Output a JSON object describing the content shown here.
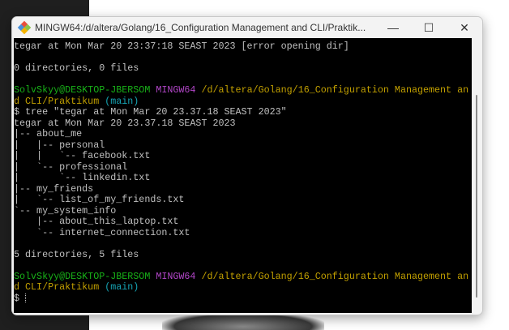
{
  "window": {
    "title": "MINGW64:/d/altera/Golang/16_Configuration Management and CLI/Praktik...",
    "minimize": "—",
    "maximize": "☐",
    "close": "✕"
  },
  "terminal": {
    "lines": [
      "tegar at Mon Mar 20 23:37:18 SEAST 2023 [error opening dir]",
      "",
      "0 directories, 0 files",
      ""
    ],
    "prompt1": {
      "user": "SolvSkyy@DESKTOP-JBERSOM",
      "system": "MINGW64",
      "path": "/d/altera/Golang/16_Configuration Management an",
      "path_cont": "d CLI/Praktikum",
      "branch": "(main)"
    },
    "output": [
      "$ tree \"tegar at Mon Mar 20 23.37.18 SEAST 2023\"",
      "tegar at Mon Mar 20 23.37.18 SEAST 2023",
      "|-- about_me",
      "|   |-- personal",
      "|   |   `-- facebook.txt",
      "|   `-- professional",
      "|       `-- linkedin.txt",
      "|-- my_friends",
      "|   `-- list_of_my_friends.txt",
      "`-- my_system_info",
      "    |-- about_this_laptop.txt",
      "    `-- internet_connection.txt",
      "",
      "5 directories, 5 files",
      ""
    ],
    "prompt2": {
      "user": "SolvSkyy@DESKTOP-JBERSOM",
      "system": "MINGW64",
      "path": "/d/altera/Golang/16_Configuration Management an",
      "path_cont": "d CLI/Praktikum",
      "branch": "(main)"
    },
    "input_prompt": "$ "
  }
}
